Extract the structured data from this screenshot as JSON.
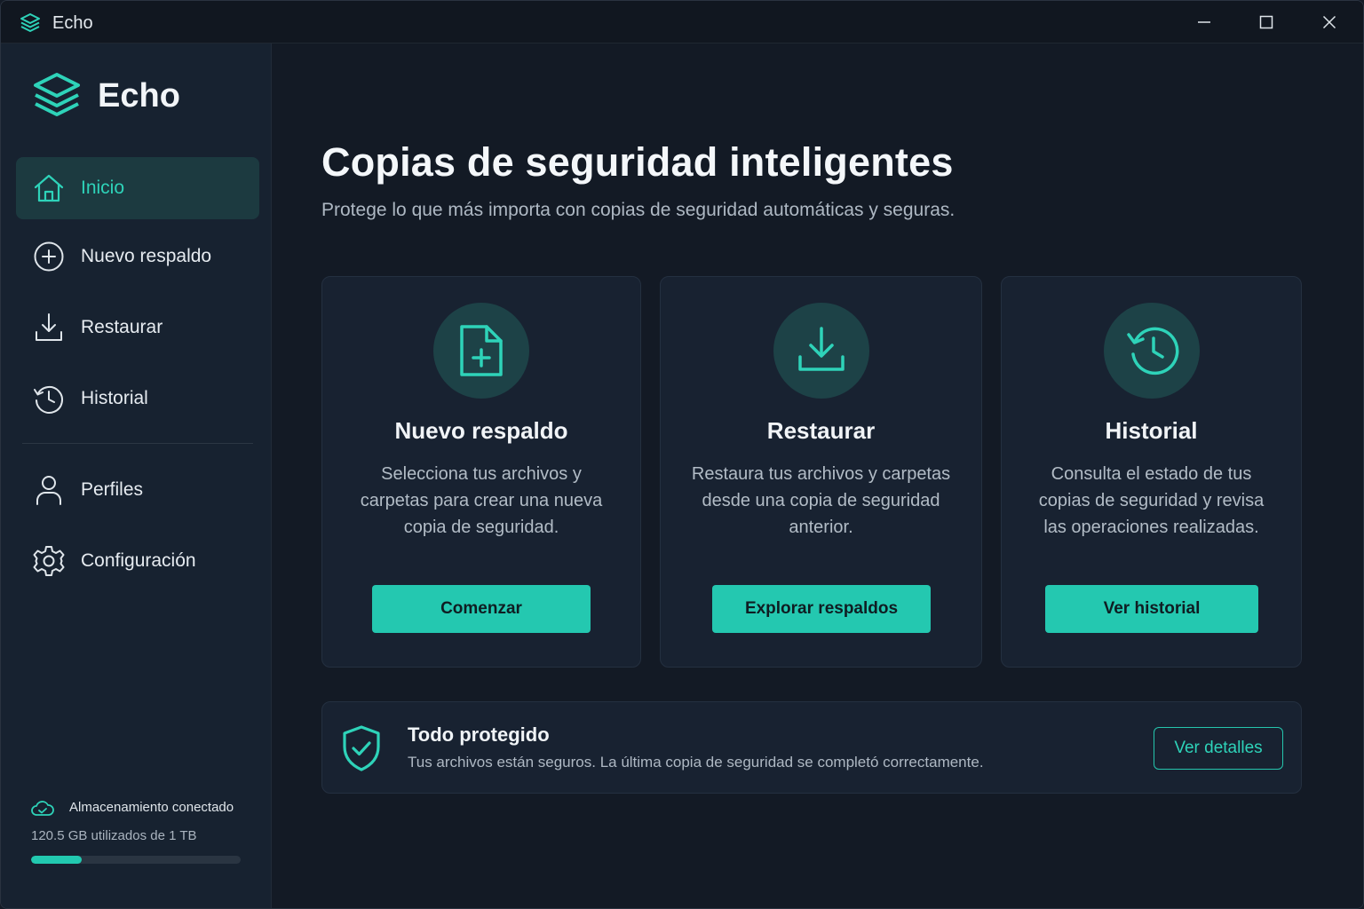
{
  "window": {
    "title": "Echo"
  },
  "sidebar": {
    "logo_text": "Echo",
    "items": [
      {
        "label": "Inicio",
        "icon": "home-icon",
        "active": true
      },
      {
        "label": "Nuevo respaldo",
        "icon": "plus-circle-icon"
      },
      {
        "label": "Restaurar",
        "icon": "download-icon"
      },
      {
        "label": "Historial",
        "icon": "history-icon"
      },
      {
        "label": "Perfiles",
        "icon": "user-icon"
      },
      {
        "label": "Configuración",
        "icon": "gear-icon"
      }
    ],
    "storage": {
      "title": "Almacenamiento conectado",
      "detail": "120.5 GB utilizados de 1 TB",
      "used_fraction": 0.24
    }
  },
  "main": {
    "title": "Copias de seguridad inteligentes",
    "subtitle": "Protege lo que más importa con copias de seguridad automáticas y seguras.",
    "cards": [
      {
        "title": "Nuevo respaldo",
        "description": "Selecciona tus archivos y carpetas para crear una nueva copia de seguridad.",
        "button": "Comenzar",
        "icon": "file-plus-icon"
      },
      {
        "title": "Restaurar",
        "description": "Restaura tus archivos y carpetas desde una copia de seguridad anterior.",
        "button": "Explorar respaldos",
        "icon": "download-icon"
      },
      {
        "title": "Historial",
        "description": "Consulta el estado de tus copias de seguridad y revisa las operaciones realizadas.",
        "button": "Ver historial",
        "icon": "history-icon"
      }
    ],
    "status": {
      "title": "Todo protegido",
      "description": "Tus archivos están seguros. La última copia de seguridad se completó correctamente.",
      "button": "Ver detalles",
      "icon": "shield-check-icon"
    }
  },
  "colors": {
    "accent": "#24c8b0",
    "background": "#131a25",
    "sidebar": "#172230",
    "card": "#182231"
  }
}
